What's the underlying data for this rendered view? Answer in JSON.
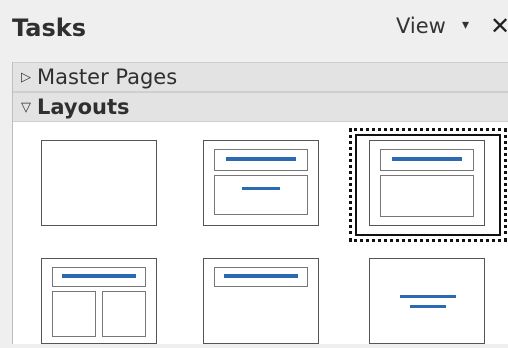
{
  "panel": {
    "title": "Tasks",
    "view_label": "View",
    "view_arrow": "▾",
    "close_glyph": "✕"
  },
  "sections": {
    "master_pages": {
      "label": "Master Pages",
      "chevron": "▷"
    },
    "layouts": {
      "label": "Layouts",
      "chevron": "▽"
    }
  },
  "layouts": [
    {
      "name": "blank-slide",
      "selected": false
    },
    {
      "name": "title-content",
      "selected": false
    },
    {
      "name": "title-and-content",
      "selected": true
    },
    {
      "name": "title-two-content",
      "selected": false
    },
    {
      "name": "title-only",
      "selected": false
    },
    {
      "name": "centered-text",
      "selected": false
    }
  ],
  "colors": {
    "accent": "#2a6ab2"
  }
}
